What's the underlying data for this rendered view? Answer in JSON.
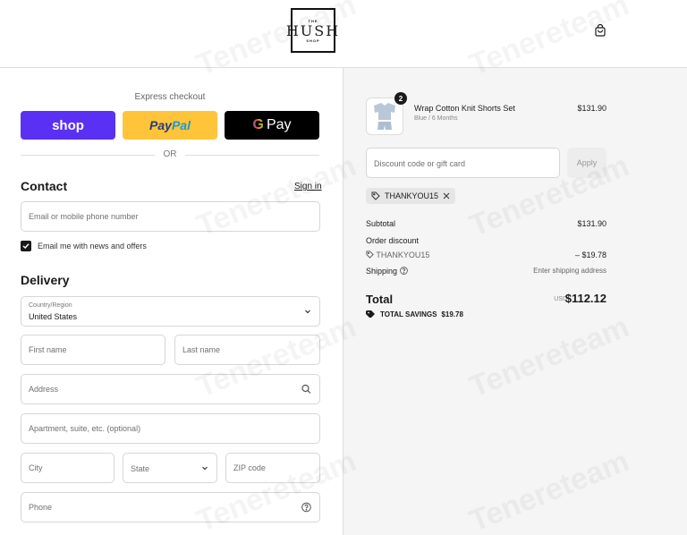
{
  "header": {
    "logo": {
      "top": "THE",
      "main": "HUSH",
      "bottom": "SHOP"
    },
    "cart_icon": "shopping-bag-icon"
  },
  "express": {
    "label": "Express checkout",
    "shop_label": "shop",
    "paypal_label_a": "Pay",
    "paypal_label_b": "Pal",
    "gpay_g": "G",
    "gpay_label": "Pay",
    "or_label": "OR"
  },
  "contact": {
    "title": "Contact",
    "signin": "Sign in",
    "email_placeholder": "Email or mobile phone number",
    "newsletter_label": "Email me with news and offers",
    "newsletter_checked": true
  },
  "delivery": {
    "title": "Delivery",
    "country_label": "Country/Region",
    "country_value": "United States",
    "first_name": "First name",
    "last_name": "Last name",
    "address": "Address",
    "apartment": "Apartment, suite, etc. (optional)",
    "city": "City",
    "state": "State",
    "zip": "ZIP code",
    "phone": "Phone"
  },
  "summary": {
    "item": {
      "name": "Wrap Cotton Knit Shorts Set",
      "variant": "Blue / 6 Months",
      "price": "$131.90",
      "quantity": "2"
    },
    "discount_placeholder": "Discount code or gift card",
    "apply_label": "Apply",
    "applied_code": "THANKYOU15",
    "subtotal_label": "Subtotal",
    "subtotal_value": "$131.90",
    "order_discount_label": "Order discount",
    "discount_code": "THANKYOU15",
    "discount_value": "– $19.78",
    "shipping_label": "Shipping",
    "shipping_value": "Enter shipping address",
    "total_label": "Total",
    "currency": "USD",
    "total_value": "$112.12",
    "savings_label": "TOTAL SAVINGS",
    "savings_value": "$19.78"
  },
  "watermark": "Tenereteam",
  "colors": {
    "shop": "#5a31f4",
    "paypal": "#ffc439",
    "gpay": "#000000"
  }
}
